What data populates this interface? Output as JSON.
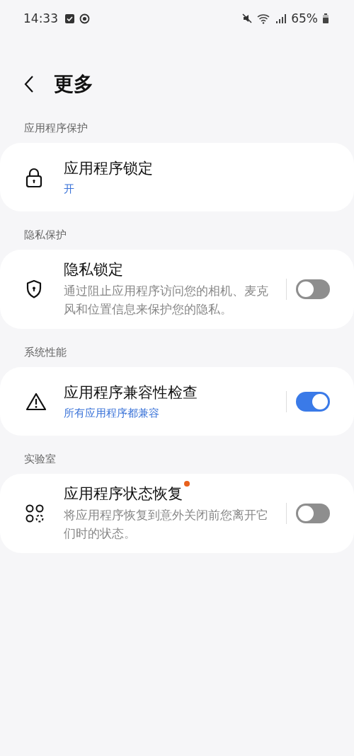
{
  "status_bar": {
    "time": "14:33",
    "battery": "65%"
  },
  "header": {
    "title": "更多"
  },
  "sections": [
    {
      "label": "应用程序保护",
      "item": {
        "kind": "lock",
        "title": "应用程序锁定",
        "status": "开",
        "new": false
      }
    },
    {
      "label": "隐私保护",
      "item": {
        "kind": "shield",
        "title": "隐私锁定",
        "description": "通过阻止应用程序访问您的相机、麦克风和位置信息来保护您的隐私。",
        "on": false,
        "new": false
      }
    },
    {
      "label": "系统性能",
      "item": {
        "kind": "warning",
        "title": "应用程序兼容性检查",
        "status": "所有应用程序都兼容",
        "on": true,
        "new": false
      }
    },
    {
      "label": "实验室",
      "item": {
        "kind": "circles",
        "title": "应用程序状态恢复",
        "description": "将应用程序恢复到意外关闭前您离开它们时的状态。",
        "on": false,
        "new": true
      }
    }
  ]
}
